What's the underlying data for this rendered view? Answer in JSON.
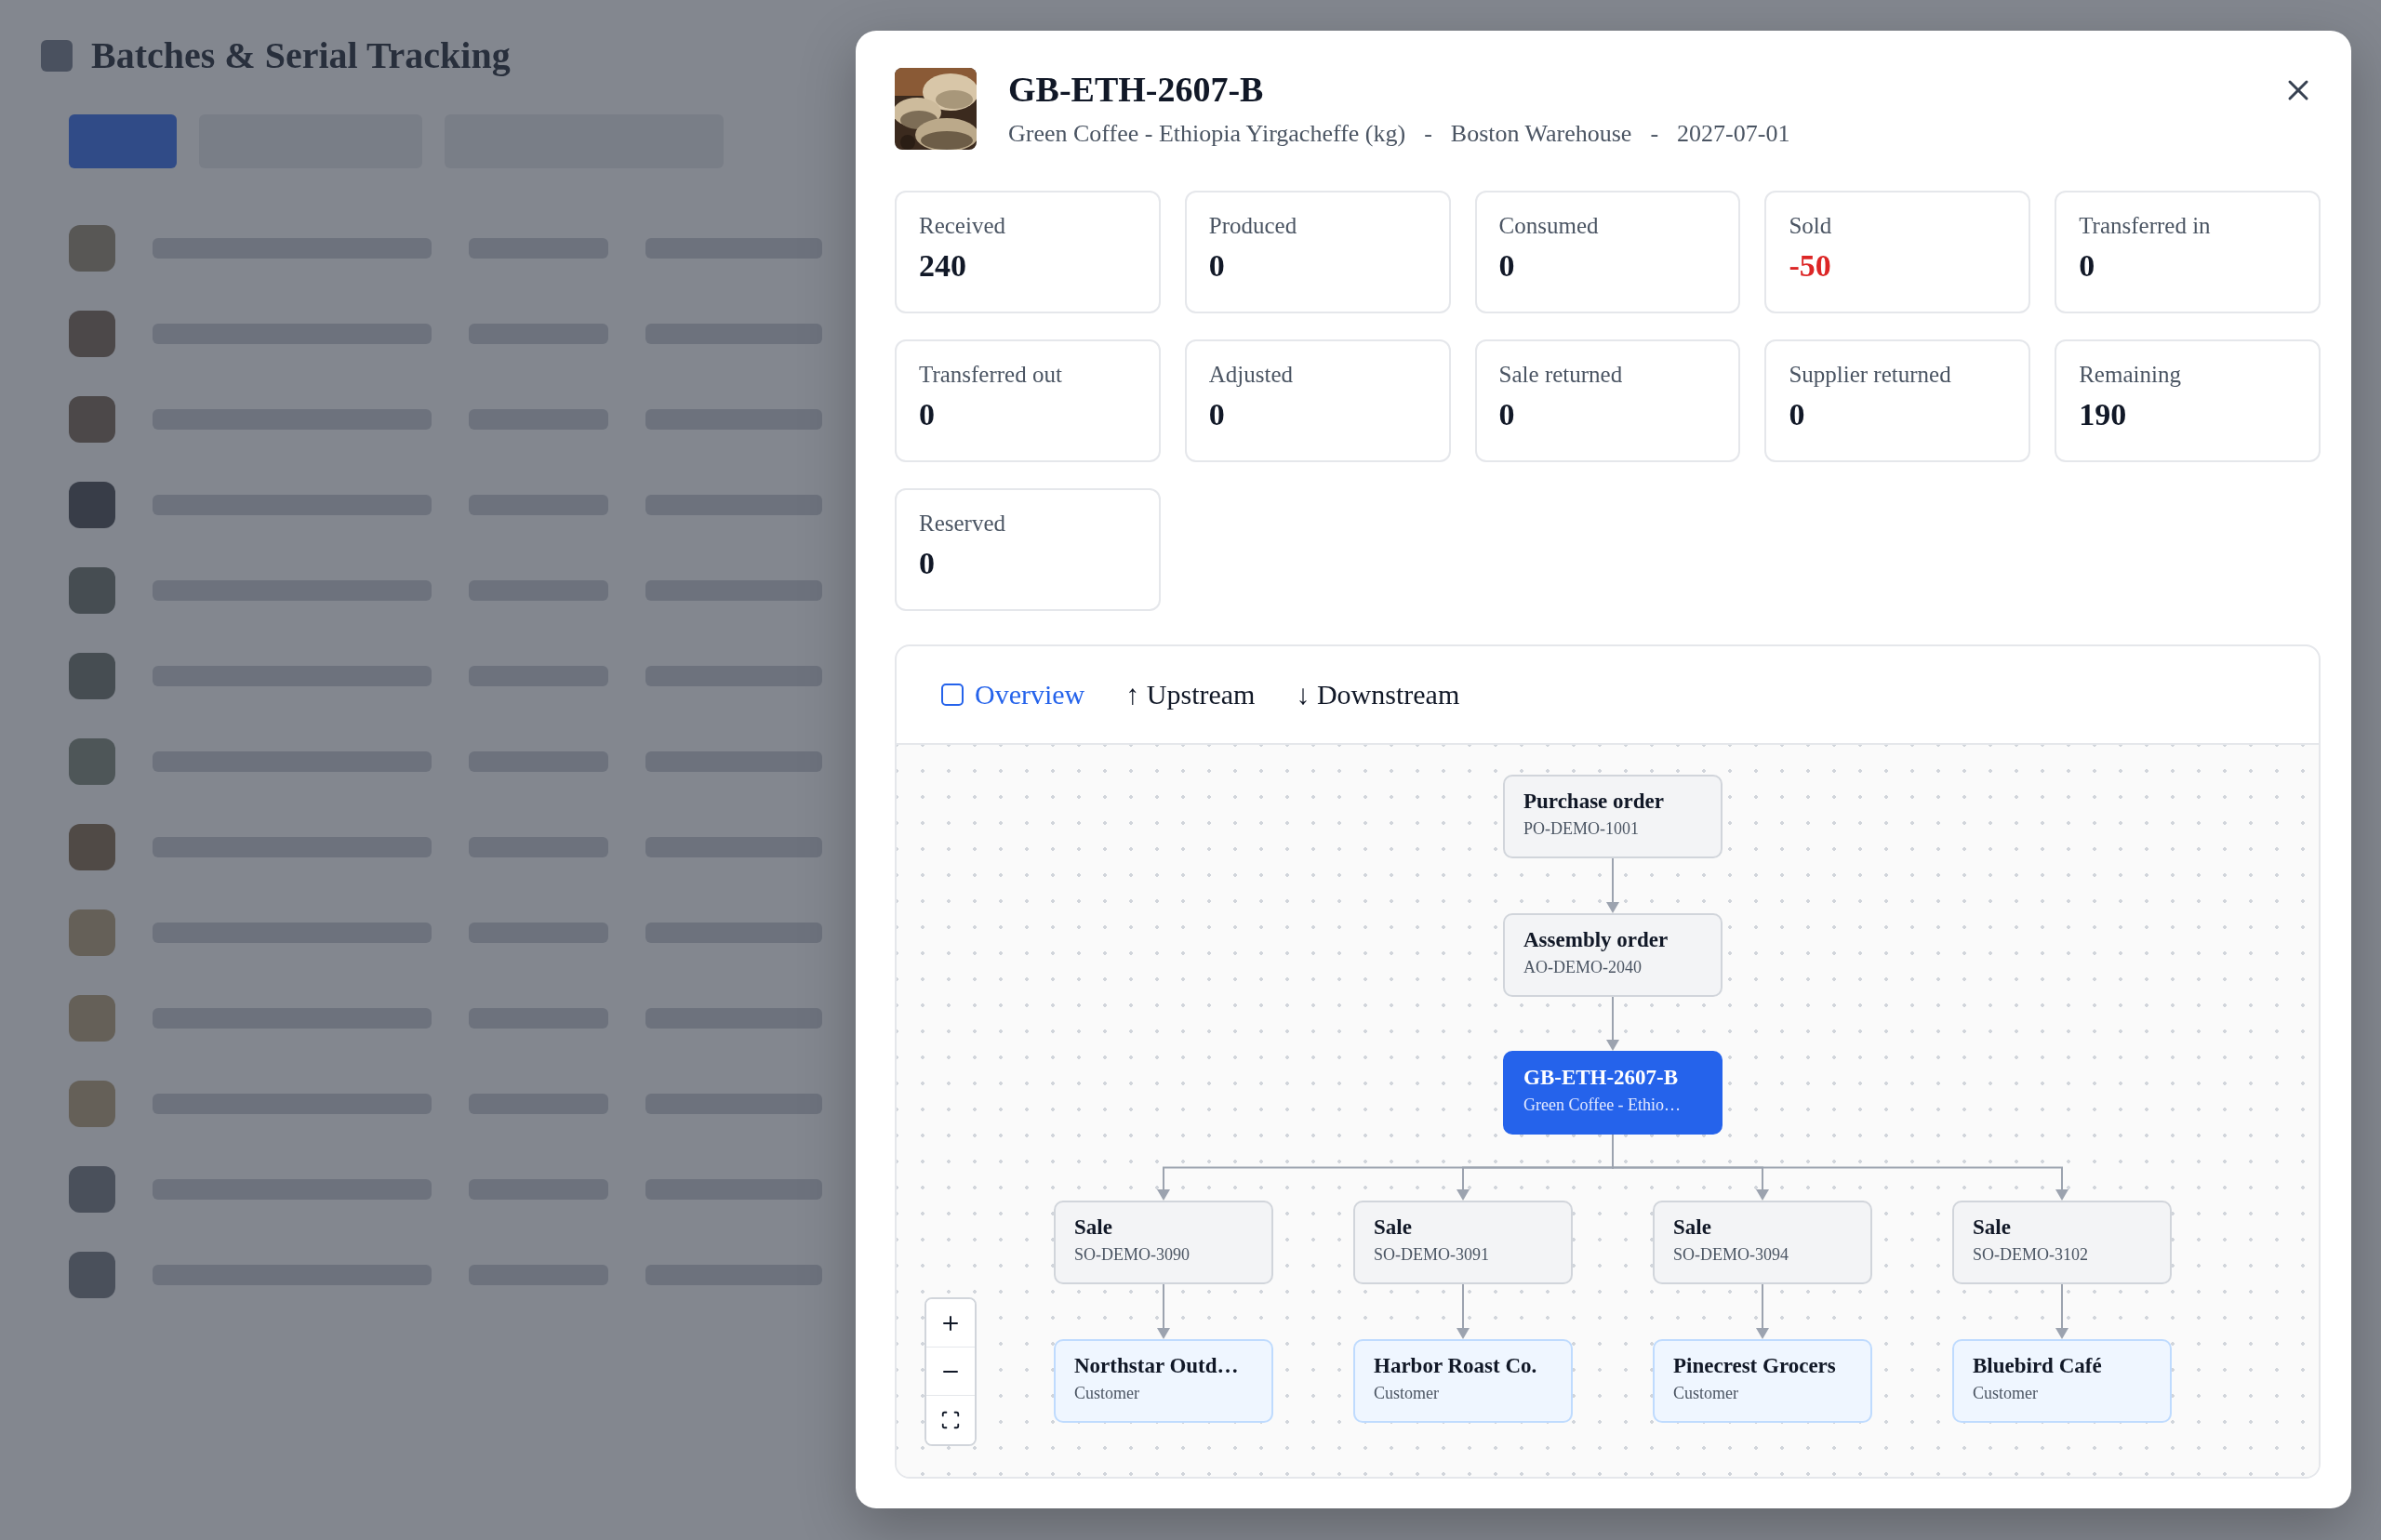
{
  "page": {
    "title": "Batches & Serial Tracking"
  },
  "modal": {
    "title": "GB-ETH-2607-B",
    "meta": [
      "Green Coffee - Ethiopia Yirgacheffe (kg)",
      "Boston Warehouse",
      "2027-07-01"
    ],
    "separator": "-",
    "stats": [
      {
        "label": "Received",
        "value": "240",
        "color": "#111827"
      },
      {
        "label": "Produced",
        "value": "0",
        "color": "#111827"
      },
      {
        "label": "Consumed",
        "value": "0",
        "color": "#111827"
      },
      {
        "label": "Sold",
        "value": "-50",
        "color": "#dc2626"
      },
      {
        "label": "Transferred in",
        "value": "0",
        "color": "#111827"
      },
      {
        "label": "Transferred out",
        "value": "0",
        "color": "#111827"
      },
      {
        "label": "Adjusted",
        "value": "0",
        "color": "#111827"
      },
      {
        "label": "Sale returned",
        "value": "0",
        "color": "#111827"
      },
      {
        "label": "Supplier returned",
        "value": "0",
        "color": "#111827"
      },
      {
        "label": "Remaining",
        "value": "190",
        "color": "#111827"
      },
      {
        "label": "Reserved",
        "value": "0",
        "color": "#111827"
      }
    ],
    "trace": {
      "tabs": [
        {
          "label": "Overview",
          "selected": true
        },
        {
          "label": "↑ Upstream",
          "selected": false
        },
        {
          "label": "↓ Downstream",
          "selected": false
        }
      ],
      "tree": {
        "kind": "document",
        "title": "Purchase order",
        "subtitle": "PO-DEMO-1001",
        "children": [
          {
            "kind": "document",
            "title": "Assembly order",
            "subtitle": "AO-DEMO-2040",
            "children": [
              {
                "kind": "current",
                "title": "GB-ETH-2607-B",
                "subtitle": "Green Coffee - Ethio…",
                "children": [
                  {
                    "kind": "document",
                    "title": "Sale",
                    "subtitle": "SO-DEMO-3090",
                    "children": [
                      {
                        "kind": "customer",
                        "title": "Northstar Outd…",
                        "subtitle": "Customer"
                      }
                    ]
                  },
                  {
                    "kind": "document",
                    "title": "Sale",
                    "subtitle": "SO-DEMO-3091",
                    "children": [
                      {
                        "kind": "customer",
                        "title": "Harbor Roast Co.",
                        "subtitle": "Customer"
                      }
                    ]
                  },
                  {
                    "kind": "document",
                    "title": "Sale",
                    "subtitle": "SO-DEMO-3094",
                    "children": [
                      {
                        "kind": "customer",
                        "title": "Pinecrest Grocers",
                        "subtitle": "Customer"
                      }
                    ]
                  },
                  {
                    "kind": "document",
                    "title": "Sale",
                    "subtitle": "SO-DEMO-3102",
                    "children": [
                      {
                        "kind": "customer",
                        "title": "Bluebird Café",
                        "subtitle": "Customer"
                      }
                    ]
                  }
                ]
              }
            ]
          }
        ]
      }
    }
  }
}
